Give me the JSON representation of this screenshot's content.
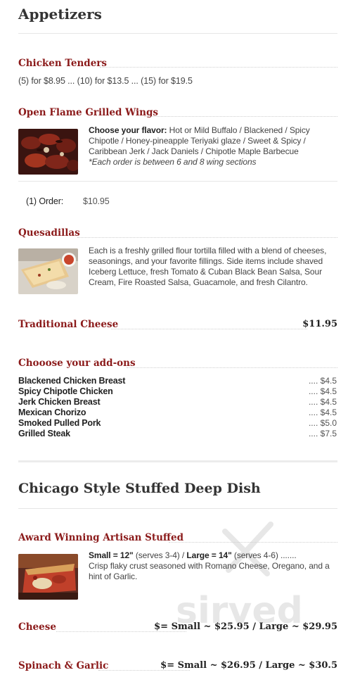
{
  "appetizers": {
    "heading": "Appetizers",
    "chicken_tenders": {
      "title": "Chicken Tenders",
      "prices": "(5) for $8.95 ... (10) for $13.5 ... (15) for $19.5"
    },
    "wings": {
      "title": "Open Flame Grilled Wings",
      "flavor_label": "Choose your flavor:",
      "flavor_text": " Hot or Mild Buffalo / Blackened / Spicy Chipotle / Honey-pineapple Teriyaki glaze / Sweet & Spicy / Caribbean Jerk / Jack Daniels /  Chipotle Maple Barbecue",
      "note": "*Each order is between 6 and 8 wing sections",
      "order_label": "(1) Order:",
      "order_price": "$10.95"
    },
    "quesadillas": {
      "title": "Quesadillas",
      "description": "Each is a freshly grilled flour tortilla filled with a blend of cheeses, seasonings, and your favorite fillings. Side items include shaved Iceberg Lettuce, fresh Tomato & Cuban Black Bean Salsa, Sour Cream, Fire Roasted Salsa, Guacamole, and fresh Cilantro.",
      "traditional_label": "Traditional Cheese",
      "traditional_price": "$11.95"
    },
    "addons": {
      "title": "Chooose your add-ons",
      "items": [
        {
          "name": "Blackened Chicken Breast",
          "price": ".... $4.5"
        },
        {
          "name": "Spicy Chipotle Chicken",
          "price": ".... $4.5"
        },
        {
          "name": "Jerk Chicken Breast",
          "price": ".... $4.5"
        },
        {
          "name": "Mexican Chorizo",
          "price": ".... $4.5"
        },
        {
          "name": "Smoked Pulled Pork",
          "price": ".... $5.0"
        },
        {
          "name": "Grilled Steak",
          "price": ".... $7.5"
        }
      ]
    }
  },
  "deep_dish": {
    "heading": "Chicago Style Stuffed Deep Dish",
    "award": {
      "title": "Award Winning Artisan Stuffed",
      "small_label": "Small = 12\"",
      "small_serves": " (serves 3-4)  / ",
      "large_label": "Large = 14\"",
      "large_serves": " (serves 4-6) .......",
      "description": "Crisp flaky crust seasoned with Romano Cheese, Oregano, and a hint of Garlic."
    },
    "cheese": {
      "label": "Cheese",
      "price": "$= Small ~ $25.95 / Large ~ $29.95"
    },
    "spinach": {
      "label": "Spinach & Garlic",
      "price": "$= Small ~ $26.95 / Large ~ $30.5"
    }
  },
  "watermark_text": "sirved",
  "colors": {
    "accent": "#8b1a1a",
    "text": "#333333",
    "rule": "#e6e6e6"
  }
}
